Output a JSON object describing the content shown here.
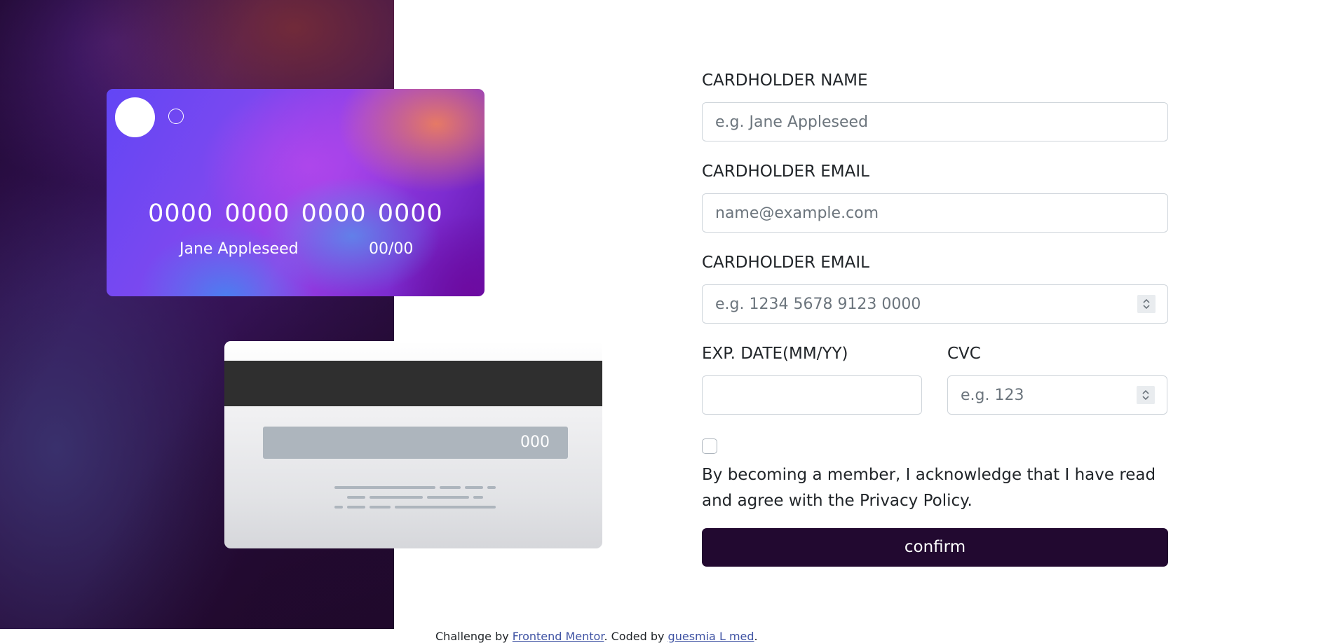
{
  "card_front": {
    "number": "0000 0000 0000 0000",
    "name": "Jane Appleseed",
    "exp": "00/00"
  },
  "card_back": {
    "cvc": "000"
  },
  "form": {
    "name_label": "CARDHOLDER NAME",
    "name_placeholder": "e.g. Jane Appleseed",
    "email_label": "CARDHOLDER EMAIL",
    "email_placeholder": "name@example.com",
    "number_label": "CARDHOLDER EMAIL",
    "number_placeholder": "e.g. 1234 5678 9123 0000",
    "exp_label": "EXP. DATE(MM/YY)",
    "exp_value": "",
    "cvc_label": "CVC",
    "cvc_placeholder": "e.g. 123",
    "terms_text": "By becoming a member, I acknowledge that I have read and agree with the Privacy Policy.",
    "terms_checked": false,
    "confirm_label": "confirm"
  },
  "footer": {
    "prefix": "Challenge by ",
    "link1": "Frontend Mentor",
    "middle": ". Coded by ",
    "link2": "guesmia L med",
    "suffix": "."
  },
  "colors": {
    "button_bg": "#220930",
    "link": "#3e52a3",
    "panel_dark": "#2a0c45"
  }
}
